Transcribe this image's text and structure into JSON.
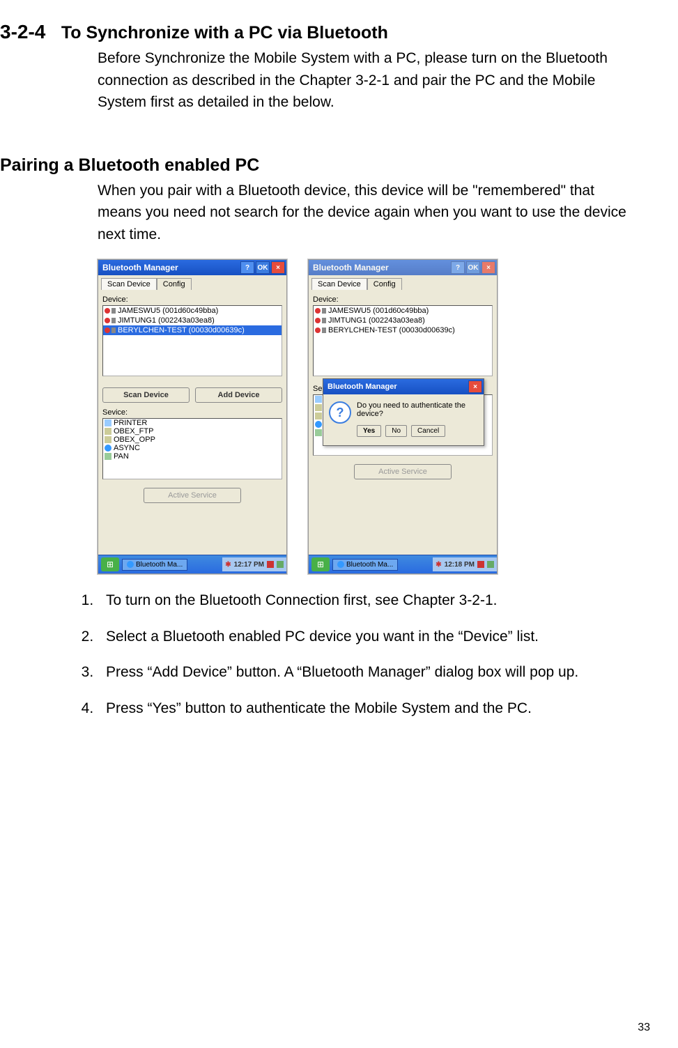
{
  "section": {
    "number": "3-2-4",
    "title": "To Synchronize with a PC via Bluetooth"
  },
  "intro": "Before Synchronize the Mobile System with a PC, please turn on the Bluetooth connection as described in the Chapter 3-2-1 and pair the PC and the Mobile System first as detailed in the below.",
  "pairHeading": "Pairing a Bluetooth enabled PC",
  "pairIntro": "When you pair with a Bluetooth device, this device will be \"remembered\" that means you need not search for the device again when you want to use the device next time.",
  "win": {
    "title": "Bluetooth Manager",
    "helpBtn": "?",
    "okBtn": "OK",
    "closeBtn": "×",
    "tabs": {
      "scan": "Scan Device",
      "config": "Config"
    },
    "deviceLabel": "Device:",
    "devices": [
      "JAMESWU5 (001d60c49bba)",
      "JIMTUNG1 (002243a03ea8)",
      "BERYLCHEN-TEST (00030d00639c)"
    ],
    "scanBtn": "Scan Device",
    "addBtn": "Add Device",
    "serviceLabel": "Sevice:",
    "services": [
      "PRINTER",
      "OBEX_FTP",
      "OBEX_OPP",
      "ASYNC",
      "PAN"
    ],
    "activeBtn": "Active Service",
    "taskbarApp": "Bluetooth Ma...",
    "time1": "12:17 PM",
    "time2": "12:18 PM"
  },
  "dialog": {
    "title": "Bluetooth Manager",
    "msg": "Do you need to authenticate the device?",
    "yes": "Yes",
    "no": "No",
    "cancel": "Cancel"
  },
  "steps": [
    "To turn on the Bluetooth Connection first, see Chapter 3-2-1.",
    "Select a Bluetooth enabled PC device you want in the “Device” list.",
    "Press “Add Device” button. A “Bluetooth Manager” dialog box will pop up.",
    "Press “Yes” button to authenticate the Mobile System and the PC."
  ],
  "pageNum": "33"
}
